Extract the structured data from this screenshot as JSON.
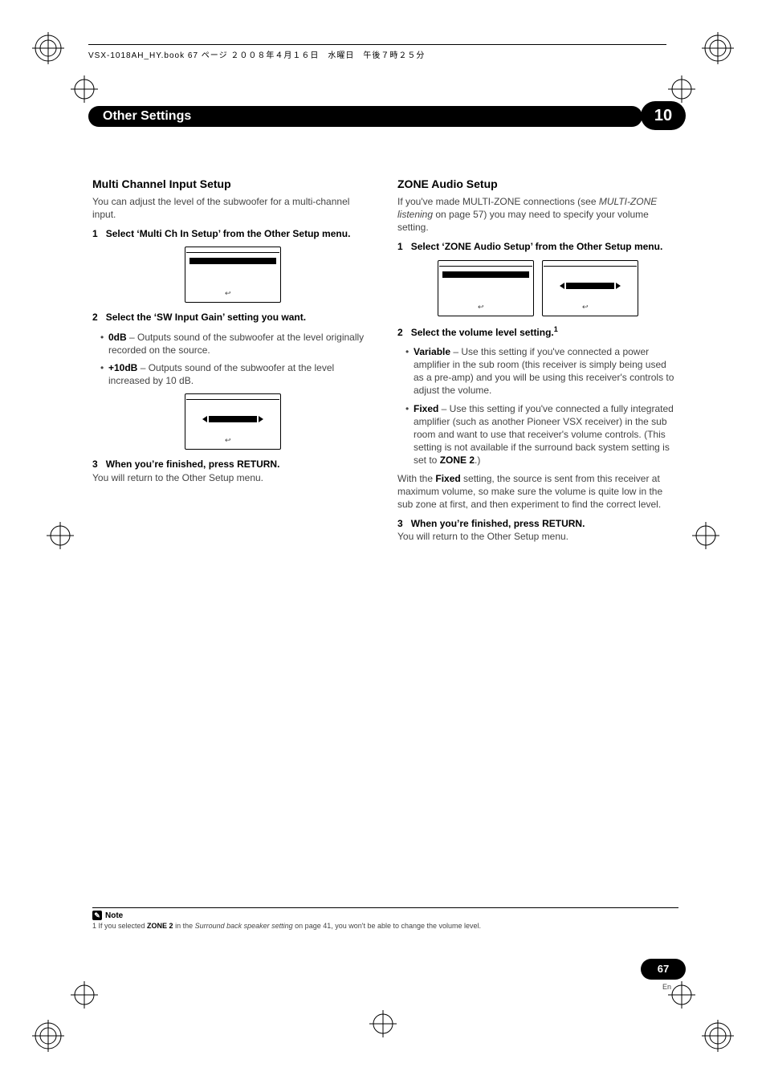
{
  "header": {
    "bookline": "VSX-1018AH_HY.book  67 ページ  ２００８年４月１６日　水曜日　午後７時２５分"
  },
  "chapter": {
    "title": "Other Settings",
    "number": "10"
  },
  "left": {
    "h2": "Multi Channel Input Setup",
    "intro": "You can adjust the level of the subwoofer for a multi-channel input.",
    "step1_num": "1",
    "step1": "Select ‘Multi Ch In Setup’ from the Other Setup menu.",
    "step2_num": "2",
    "step2": "Select the ‘SW Input Gain’ setting you want.",
    "bullet1_b": "0dB",
    "bullet1": " – Outputs sound of the subwoofer at the level originally recorded on the source.",
    "bullet2_b": "+10dB",
    "bullet2": " – Outputs sound of the subwoofer at the level increased by 10 dB.",
    "step3_num": "3",
    "step3": "When you’re finished, press RETURN.",
    "step3_after": "You will return to the Other Setup menu."
  },
  "right": {
    "h2": "ZONE Audio Setup",
    "intro_a": "If you've made MULTI-ZONE connections (see ",
    "intro_ital": "MULTI-ZONE listening",
    "intro_b": " on page 57) you may need to specify your volume setting.",
    "step1_num": "1",
    "step1": "Select ‘ZONE Audio Setup’ from the Other Setup menu.",
    "step2_num": "2",
    "step2": "Select the volume level setting.",
    "step2_sup": "1",
    "bullet1_b": "Variable",
    "bullet1": " – Use this setting if you've connected a power amplifier in the sub room (this receiver is simply being used as a pre-amp) and you will be using this receiver's controls to adjust the volume.",
    "bullet2_b": "Fixed",
    "bullet2_a": " – Use this setting if you've connected a fully integrated amplifier (such as another Pioneer VSX receiver) in the sub room and want to use that receiver's volume controls. (This setting is not available if the surround back system setting is set to ",
    "bullet2_bold2": "ZONE 2",
    "bullet2_b2": ".)",
    "fixed_para_a": "With the ",
    "fixed_para_b": "Fixed",
    "fixed_para_c": " setting, the source is sent from this receiver at maximum volume, so make sure the volume is quite low in the sub zone at first, and then experiment to find the correct level.",
    "step3_num": "3",
    "step3": "When you’re finished, press RETURN.",
    "step3_after": "You will return to the Other Setup menu."
  },
  "note": {
    "label": "Note",
    "text_a": "1 If you selected ",
    "text_b": "ZONE 2",
    "text_c": " in the ",
    "text_ital": "Surround back speaker setting",
    "text_d": " on page 41, you won't be able to change the volume level."
  },
  "footer": {
    "pagenum": "67",
    "lang": "En"
  },
  "icons": {
    "return": "↩"
  }
}
